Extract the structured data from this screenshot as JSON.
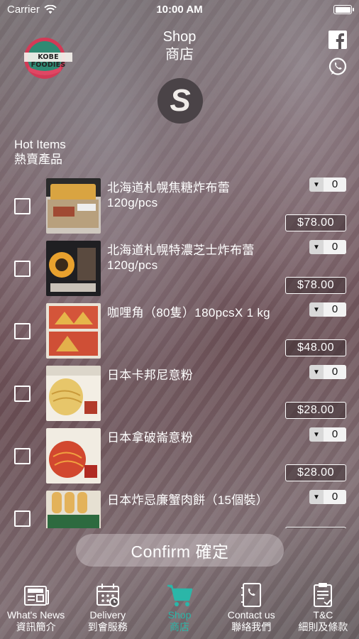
{
  "status_bar": {
    "carrier": "Carrier",
    "time": "10:00 AM"
  },
  "header": {
    "title_en": "Shop",
    "title_zh": "商店",
    "logo_text": "KOBE FOODIES",
    "badge_letter": "S"
  },
  "section": {
    "title_en": "Hot Items",
    "title_zh": "熱賣產品"
  },
  "products": [
    {
      "name": "北海道札幌焦糖炸布蕾 120g/pcs",
      "qty": "0",
      "price": "$78.00"
    },
    {
      "name": "北海道札幌特濃芝士炸布蕾 120g/pcs",
      "qty": "0",
      "price": "$78.00"
    },
    {
      "name": "咖哩角（80隻）180pcsX 1 kg",
      "qty": "0",
      "price": "$48.00"
    },
    {
      "name": "日本卡邦尼意粉",
      "qty": "0",
      "price": "$28.00"
    },
    {
      "name": "日本拿破崙意粉",
      "qty": "0",
      "price": "$28.00"
    },
    {
      "name": "日本炸忌廉蟹肉餅（15個裝）",
      "qty": "0",
      "price": ""
    }
  ],
  "confirm_label": "Confirm 確定",
  "tabs": [
    {
      "en": "What's News",
      "zh": "資訊簡介",
      "icon": "newspaper-icon"
    },
    {
      "en": "Delivery",
      "zh": "到會服務",
      "icon": "calendar-icon"
    },
    {
      "en": "Shop",
      "zh": "商店",
      "icon": "cart-icon",
      "active": true
    },
    {
      "en": "Contact us",
      "zh": "聯絡我們",
      "icon": "phone-book-icon"
    },
    {
      "en": "T&C",
      "zh": "細則及條款",
      "icon": "clipboard-icon"
    }
  ],
  "colors": {
    "accent": "#2bb6a8",
    "badge": "#4a4347"
  }
}
